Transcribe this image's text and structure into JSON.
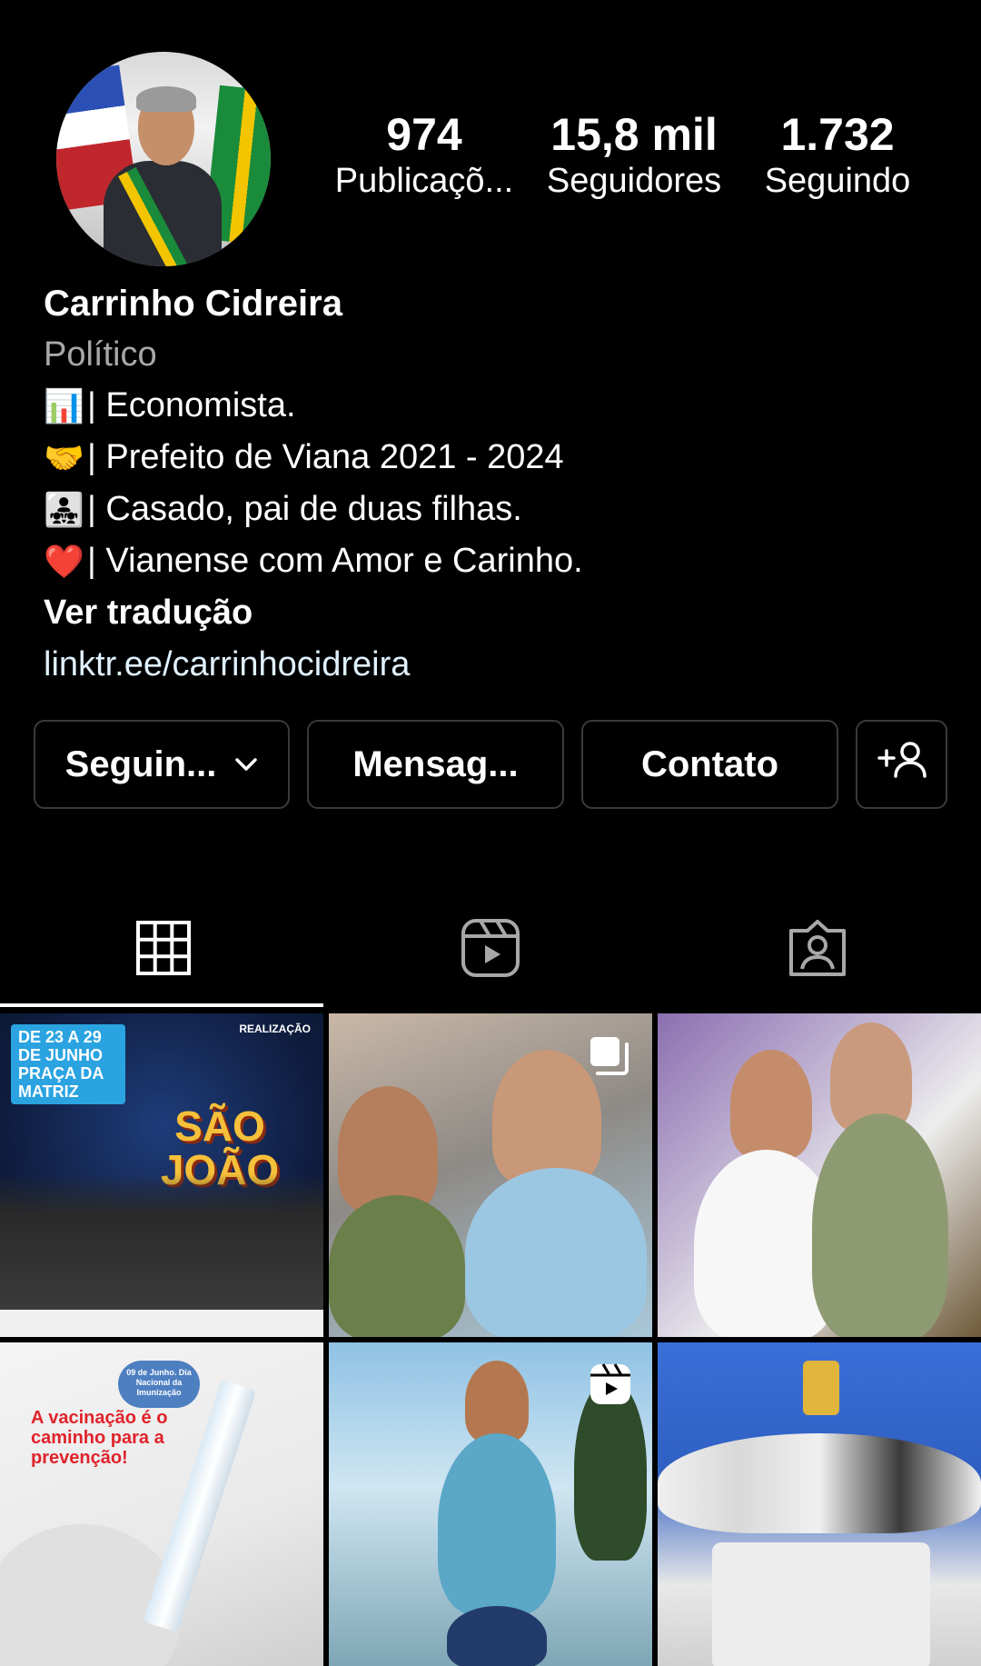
{
  "profile": {
    "name": "Carrinho Cidreira",
    "category": "Político",
    "avatar_icon": "profile-photo"
  },
  "stats": [
    {
      "value": "974",
      "label": "Publicaçõ..."
    },
    {
      "value": "15,8 mil",
      "label": "Seguidores"
    },
    {
      "value": "1.732",
      "label": "Seguindo"
    }
  ],
  "bio": {
    "lines": [
      {
        "emoji": "📊",
        "text": "| Economista."
      },
      {
        "emoji": "🤝",
        "text": "| Prefeito de Viana 2021 - 2024"
      },
      {
        "emoji": "👨‍👧‍👧",
        "text": "| Casado, pai de duas filhas."
      },
      {
        "emoji": "❤️",
        "text": "| Vianense com Amor e Carinho."
      }
    ],
    "translate": "Ver tradução",
    "link": "linktr.ee/carrinhocidreira"
  },
  "actions": {
    "following": "Seguin...",
    "message": "Mensag...",
    "contact": "Contato",
    "suggest_icon": "add-person-icon"
  },
  "tabs": [
    {
      "name": "grid",
      "icon": "grid-icon",
      "active": true
    },
    {
      "name": "reels",
      "icon": "reels-icon",
      "active": false
    },
    {
      "name": "tagged",
      "icon": "tagged-icon",
      "active": false
    }
  ],
  "posts": [
    {
      "type": "image",
      "date_text": "DE 23 A 29 DE JUNHO PRAÇA DA MATRIZ",
      "title": "SÃO JOÃO",
      "realizacao": "REALIZAÇÃO"
    },
    {
      "type": "carousel"
    },
    {
      "type": "image"
    },
    {
      "type": "image",
      "tag": "09 de Junho. Dia Nacional da Imunização",
      "headline": "A vacinação é o caminho para a prevenção!"
    },
    {
      "type": "reel"
    },
    {
      "type": "image"
    }
  ],
  "colors": {
    "background": "#000000",
    "text": "#ffffff",
    "muted": "#a8a8a8",
    "link": "#e0f1ff",
    "button_border": "#3a3a3a"
  }
}
